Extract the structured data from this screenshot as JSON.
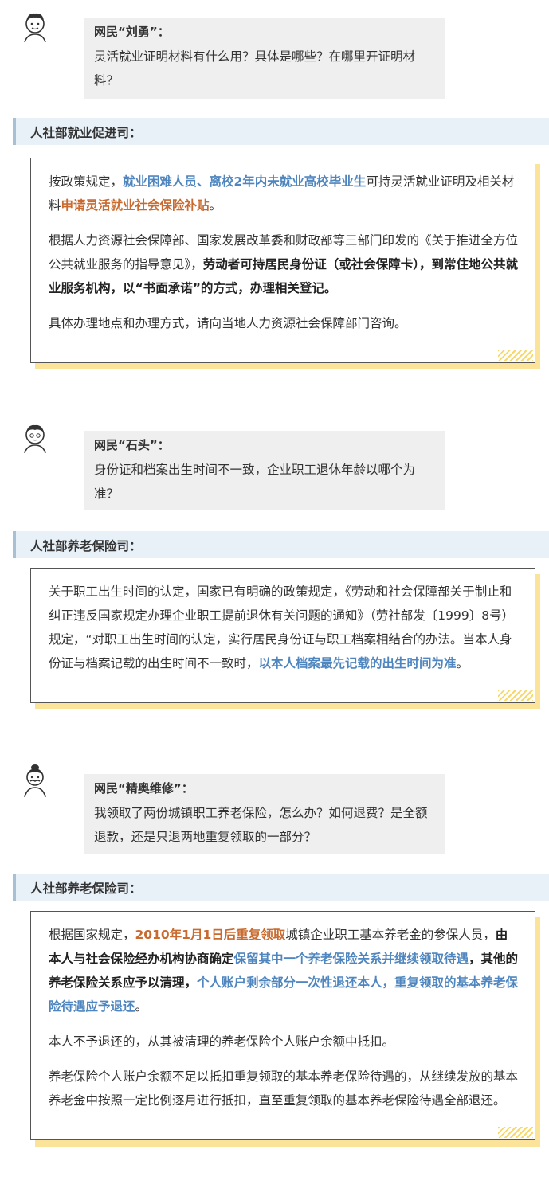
{
  "sections": [
    {
      "name": "网民“刘勇”：",
      "question": "灵活就业证明材料有什么用？具体是哪些？在哪里开证明材料？",
      "department": "人社部就业促进司：",
      "paragraphs": [
        [
          {
            "t": "按政策规定，",
            "s": "n"
          },
          {
            "t": "就业困难人员、离校2年内未就业高校毕业生",
            "s": "b"
          },
          {
            "t": "可持灵活就业证明及相关材料",
            "s": "n"
          },
          {
            "t": "申请灵活就业社会保险补贴",
            "s": "o"
          },
          {
            "t": "。",
            "s": "n"
          }
        ],
        [
          {
            "t": "根据人力资源社会保障部、国家发展改革委和财政部等三部门印发的《关于推进全方位公共就业服务的指导意见》，",
            "s": "n"
          },
          {
            "t": "劳动者可持居民身份证（或社会保障卡），到常住地公共就业服务机构，以“书面承诺”的方式，办理相关登记。",
            "s": "k"
          }
        ],
        [
          {
            "t": "具体办理地点和办理方式，请向当地人力资源社会保障部门咨询。",
            "s": "n"
          }
        ]
      ]
    },
    {
      "name": "网民“石头”：",
      "question": "身份证和档案出生时间不一致，企业职工退休年龄以哪个为准？",
      "department": "人社部养老保险司：",
      "paragraphs": [
        [
          {
            "t": "关于职工出生时间的认定，国家已有明确的政策规定，《劳动和社会保障部关于制止和纠正违反国家规定办理企业职工提前退休有关问题的通知》（劳社部发〔1999〕8号）规定，“对职工出生时间的认定，实行居民身份证与职工档案相结合的办法。当本人身份证与档案记载的出生时间不一致时，",
            "s": "n"
          },
          {
            "t": "以本人档案最先记载的出生时间为准",
            "s": "b"
          },
          {
            "t": "。",
            "s": "n"
          }
        ]
      ]
    },
    {
      "name": "网民“精奥维修”：",
      "question": "我领取了两份城镇职工养老保险，怎么办？如何退费？是全额退款，还是只退两地重复领取的一部分？",
      "department": "人社部养老保险司：",
      "paragraphs": [
        [
          {
            "t": "根据国家规定，",
            "s": "n"
          },
          {
            "t": "2010年1月1日后重复领取",
            "s": "o"
          },
          {
            "t": "城镇企业职工基本养老金的参保人员，",
            "s": "n"
          },
          {
            "t": "由本人与社会保险经办机构协商确定",
            "s": "k"
          },
          {
            "t": "保留其中一个养老保险关系并继续领取待遇",
            "s": "b"
          },
          {
            "t": "，其他的养老保险关系应予以清理，",
            "s": "k"
          },
          {
            "t": "个人账户剩余部分一次性退还本人，重复领取的基本养老保险待遇应予退还",
            "s": "b"
          },
          {
            "t": "。",
            "s": "n"
          }
        ],
        [
          {
            "t": "本人不予退还的，从其被清理的养老保险个人账户余额中抵扣。",
            "s": "n"
          }
        ],
        [
          {
            "t": "养老保险个人账户余额不足以抵扣重复领取的基本养老保险待遇的，从继续发放的基本养老金中按照一定比例逐月进行抵扣，直至重复领取的基本养老保险待遇全部退还。",
            "s": "n"
          }
        ]
      ]
    }
  ]
}
